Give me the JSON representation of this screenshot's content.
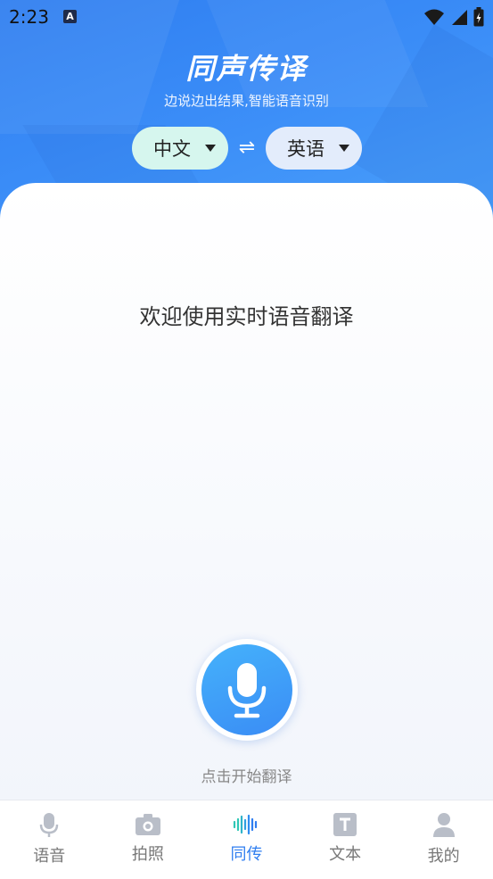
{
  "status_bar": {
    "time": "2:23",
    "notification_icon_letter": "A",
    "icons": [
      "wifi-icon",
      "signal-icon",
      "battery-icon"
    ]
  },
  "header": {
    "title": "同声传译",
    "subtitle": "边说边出结果,智能语音识别",
    "source_language": "中文",
    "target_language": "英语",
    "swap_icon": "⇌"
  },
  "main": {
    "welcome_text": "欢迎使用实时语音翻译",
    "start_hint": "点击开始翻译"
  },
  "tabs": [
    {
      "label": "语音",
      "icon": "microphone-icon"
    },
    {
      "label": "拍照",
      "icon": "camera-icon"
    },
    {
      "label": "同传",
      "icon": "waveform-icon",
      "active": true
    },
    {
      "label": "文本",
      "icon": "text-icon"
    },
    {
      "label": "我的",
      "icon": "person-icon"
    }
  ],
  "colors": {
    "accent": "#2f7ef0",
    "header_gradient_start": "#2f7ef0",
    "header_gradient_end": "#4aa0fb",
    "source_pill": "#d6f6ee",
    "target_pill": "#e3ecfb",
    "inactive_tab": "#777777"
  }
}
